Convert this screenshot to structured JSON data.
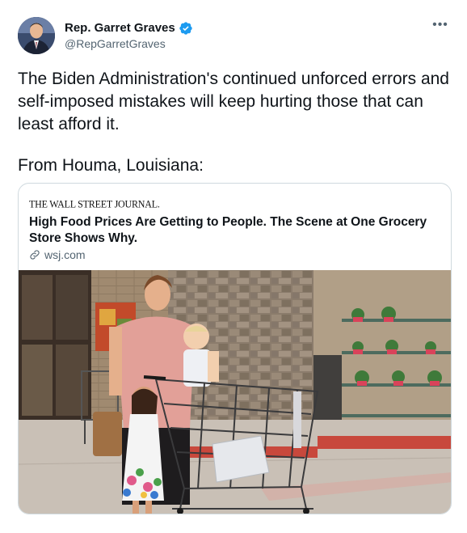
{
  "author": {
    "display_name": "Rep. Garret Graves",
    "handle": "@RepGarretGraves",
    "verified": true,
    "verified_color": "#1d9bf0"
  },
  "more_icon": "more-horizontal-icon",
  "tweet": {
    "text_paragraph_1": "The Biden Administration's continued unforced errors and self-imposed mistakes will keep hurting those that can least afford it.",
    "text_paragraph_2": "From Houma, Louisiana:"
  },
  "card": {
    "publisher": "THE WALL STREET JOURNAL.",
    "headline": "High Food Prices Are Getting to People. The Scene at One Grocery Store Shows Why.",
    "domain": "wsj.com",
    "link_icon": "link-icon",
    "image": "photo of a woman with two children and a shopping cart outside a grocery store"
  },
  "colors": {
    "text_primary": "#0f1419",
    "text_secondary": "#536471",
    "border": "#cfd9de"
  }
}
